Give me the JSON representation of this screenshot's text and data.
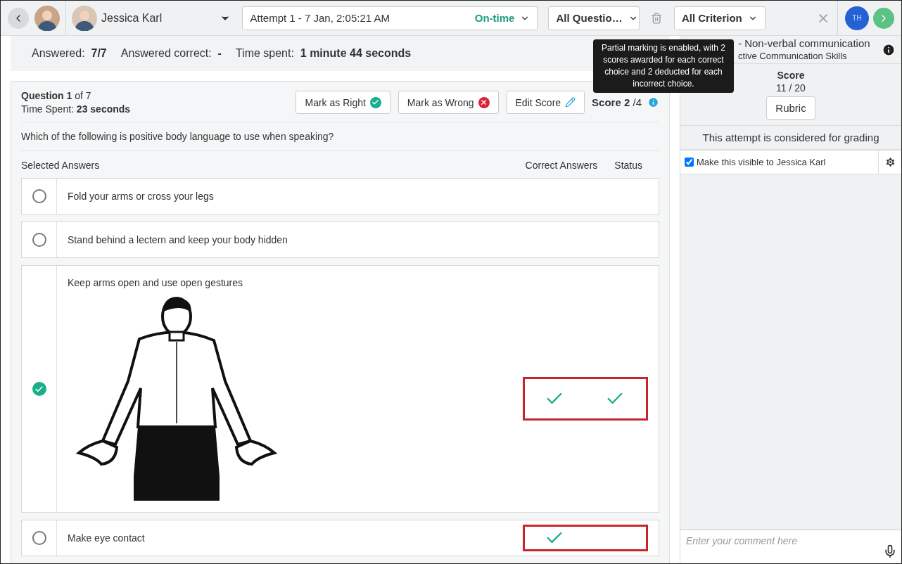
{
  "topbar": {
    "student": {
      "name": "Jessica Karl"
    },
    "attempt": {
      "label": "Attempt 1 - 7 Jan, 2:05:21 AM",
      "status": "On-time"
    },
    "question_filter": "All Questio…",
    "criterion_filter": "All Criterion",
    "user_initials": "TH"
  },
  "summary": [
    "Answered:  **7/7**",
    "Answered correct:  **-**",
    "Time spent:  **1 minute 44 seconds**"
  ],
  "question": {
    "title": "**Question 1** of 7",
    "time": "Time Spent: **23 seconds**",
    "buttons": [
      {
        "label": "Mark as Right",
        "kind": "right"
      },
      {
        "label": "Mark as Wrong",
        "kind": "wrong"
      },
      {
        "label": "Edit Score",
        "kind": "edit"
      }
    ],
    "score": "**Score 2** /4",
    "text": "Which of the following is positive body language to use when speaking?",
    "headers": {
      "selected": "Selected Answers",
      "correct": "Correct Answers",
      "status": "Status"
    },
    "answers": [
      {
        "text": "Fold your arms or cross your legs",
        "kind": "text",
        "selected": false,
        "correct": false,
        "status": false,
        "highlighted": false
      },
      {
        "text": "Stand behind a lectern and keep your body hidden",
        "kind": "text",
        "selected": false,
        "correct": false,
        "status": false,
        "highlighted": false
      },
      {
        "text": "Keep arms open and use open gestures",
        "kind": "picture",
        "selected": true,
        "correct": true,
        "status": true,
        "highlighted": true
      },
      {
        "text": "Make eye contact",
        "kind": "text",
        "selected": false,
        "correct": true,
        "status": false,
        "highlighted": true
      }
    ]
  },
  "tooltip": {
    "text": "Partial marking is enabled, with 2 scores awarded for each correct choice and 2 deducted for each incorrect choice."
  },
  "sidebar": {
    "title": "- Non-verbal communication",
    "subtitle": "ctive Communication Skills",
    "score_label": "Score",
    "score": "11 / 20",
    "rubric": "Rubric",
    "grading_note": "This attempt is considered for grading",
    "visibility": {
      "label": "Make this visible to Jessica Karl",
      "checked": true
    },
    "comment": {
      "placeholder": "Enter your comment here"
    }
  }
}
